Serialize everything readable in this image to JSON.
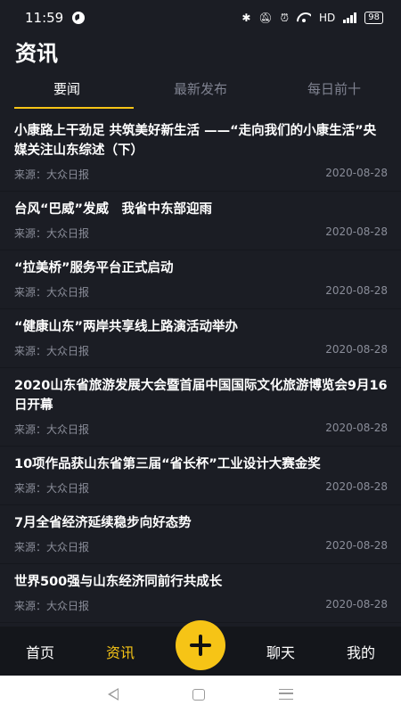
{
  "status_bar": {
    "time": "11:59",
    "network": "HD",
    "battery": "98"
  },
  "header": {
    "title": "资讯"
  },
  "tabs": [
    {
      "label": "要闻",
      "active": true
    },
    {
      "label": "最新发布",
      "active": false
    },
    {
      "label": "每日前十",
      "active": false
    }
  ],
  "news": [
    {
      "title": "小康路上干劲足 共筑美好新生活 ——“走向我们的小康生活”央媒关注山东综述（下）",
      "source": "来源：大众日报",
      "date": "2020-08-28"
    },
    {
      "title": "台风“巴威”发威　我省中东部迎雨",
      "source": "来源：大众日报",
      "date": "2020-08-28"
    },
    {
      "title": "“拉美桥”服务平台正式启动",
      "source": "来源：大众日报",
      "date": "2020-08-28"
    },
    {
      "title": "“健康山东”两岸共享线上路演活动举办",
      "source": "来源：大众日报",
      "date": "2020-08-28"
    },
    {
      "title": "2020山东省旅游发展大会暨首届中国国际文化旅游博览会9月16日开幕",
      "source": "来源：大众日报",
      "date": "2020-08-28"
    },
    {
      "title": "10项作品获山东省第三届“省长杯”工业设计大赛金奖",
      "source": "来源：大众日报",
      "date": "2020-08-28"
    },
    {
      "title": "7月全省经济延续稳步向好态势",
      "source": "来源：大众日报",
      "date": "2020-08-28"
    },
    {
      "title": "世界500强与山东经济同前行共成长",
      "source": "来源：大众日报",
      "date": "2020-08-28"
    }
  ],
  "bottom_nav": {
    "home": "首页",
    "news": "资讯",
    "chat": "聊天",
    "mine": "我的"
  },
  "colors": {
    "accent": "#f6c416",
    "background": "#1b1d24",
    "muted": "#8a8d99"
  }
}
